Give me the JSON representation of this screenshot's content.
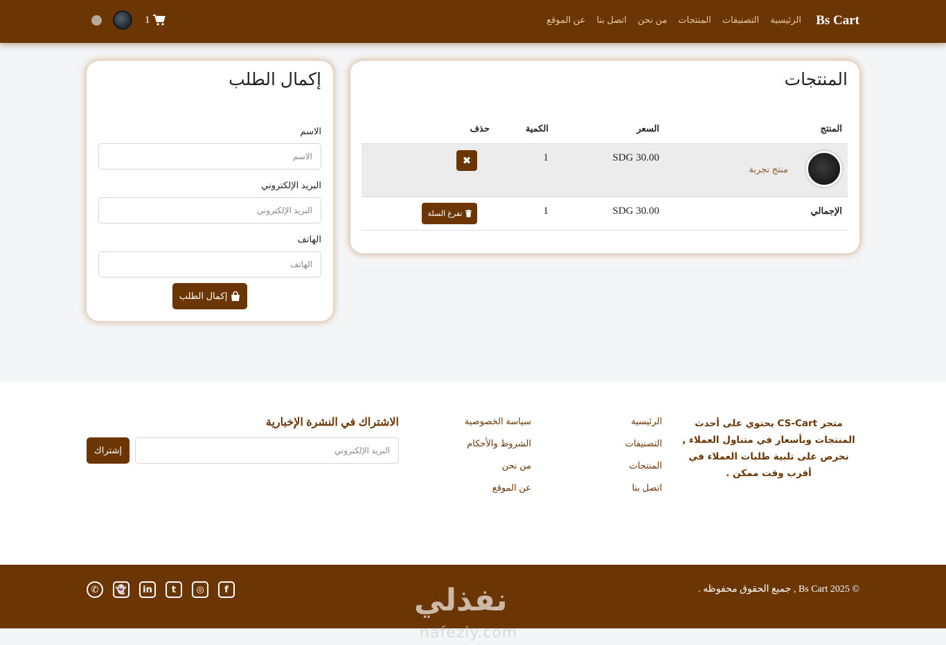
{
  "nav": {
    "brand": "Bs Cart",
    "links": [
      "الرئيسية",
      "التصنيفات",
      "المنتجات",
      "من نحن",
      "اتصل بنا",
      "عن الموقع"
    ],
    "cart_count": "1",
    "icons": [
      "globe-icon",
      "avatar",
      "cart-icon"
    ]
  },
  "products": {
    "title": "المنتجات",
    "headers": {
      "product": "المنتج",
      "price": "السعر",
      "qty": "الكمية",
      "delete": "حذف"
    },
    "item": {
      "name": "منتج تجربة",
      "price": "SDG 30.00",
      "qty": "1",
      "delete_icon": "✖"
    },
    "total": {
      "label": "الإجمالي",
      "price": "SDG 30.00",
      "qty": "1",
      "empty_label": "تفرغ السلة"
    }
  },
  "order": {
    "title": "إكمال الطلب",
    "name_label": "الاسم",
    "name_placeholder": "الاسم",
    "email_label": "البريد الإلكتروني",
    "email_placeholder": "البريد الإلكتروني",
    "phone_label": "الهاتف",
    "phone_placeholder": "الهاتف",
    "submit": "إكمال الطلب"
  },
  "footer": {
    "about": "متجر CS-Cart يحتوي على أحدث المنتجات وبأسعار في متناول العملاء , نحرص على تلبية طلبات العملاء في أقرب وقت ممكن .",
    "links_1": [
      "الرئيسية",
      "التصنيفات",
      "المنتجات",
      "اتصل بنا"
    ],
    "links_2": [
      "سياسة الخصوصية",
      "الشروط والأحكام",
      "من نحن",
      "عن الموقع"
    ],
    "newsletter_title": "الاشتراك في النشرة الإخبارية",
    "newsletter_placeholder": "البريد الإلكتروني",
    "subscribe": "إشتراك"
  },
  "bottom": {
    "copyright": "© Bs Cart 2025 , جميع الحقوق محفوظه .",
    "social": [
      "whatsapp-icon",
      "snapchat-icon",
      "linkedin-icon",
      "twitter-icon",
      "instagram-icon",
      "facebook-icon"
    ],
    "watermark": "نفذلي",
    "watermark_sub": "nafezly.com"
  },
  "colors": {
    "primary": "#6b3604",
    "link": "#e8c9a3",
    "background": "#f4f5f7"
  }
}
